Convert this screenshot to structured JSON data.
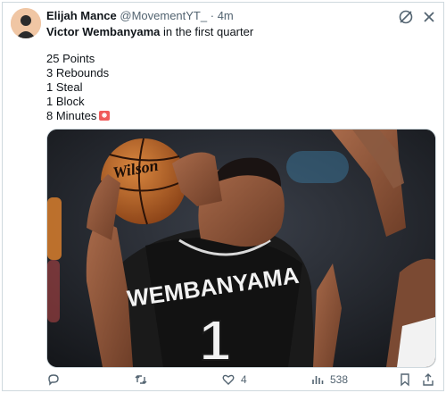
{
  "tweet": {
    "author_name": "Elijah Mance",
    "author_handle": "@MovementYT_",
    "separator": "·",
    "time": "4m",
    "headline_bold": "Victor Wembanyama",
    "headline_rest": " in the first quarter",
    "stats": [
      "25 Points",
      "3 Rebounds",
      "1 Steal",
      "1 Block",
      "8 Minutes"
    ],
    "stats_emoji": "siren-emoji-icon",
    "media": {
      "ball_brand": "Wilson",
      "jersey_name": "WEMBANYAMA",
      "jersey_number": "1"
    }
  },
  "actions": {
    "reply_count": "",
    "repost_count": "",
    "like_count": "4",
    "views_count": "538"
  },
  "icons": {
    "header": [
      "grok-icon",
      "close-icon"
    ],
    "actions": [
      "reply-icon",
      "repost-icon",
      "like-icon",
      "views-icon",
      "bookmark-icon",
      "share-icon"
    ]
  },
  "colors": {
    "text": "#0f1419",
    "muted": "#536471",
    "border": "#cfd9de"
  }
}
